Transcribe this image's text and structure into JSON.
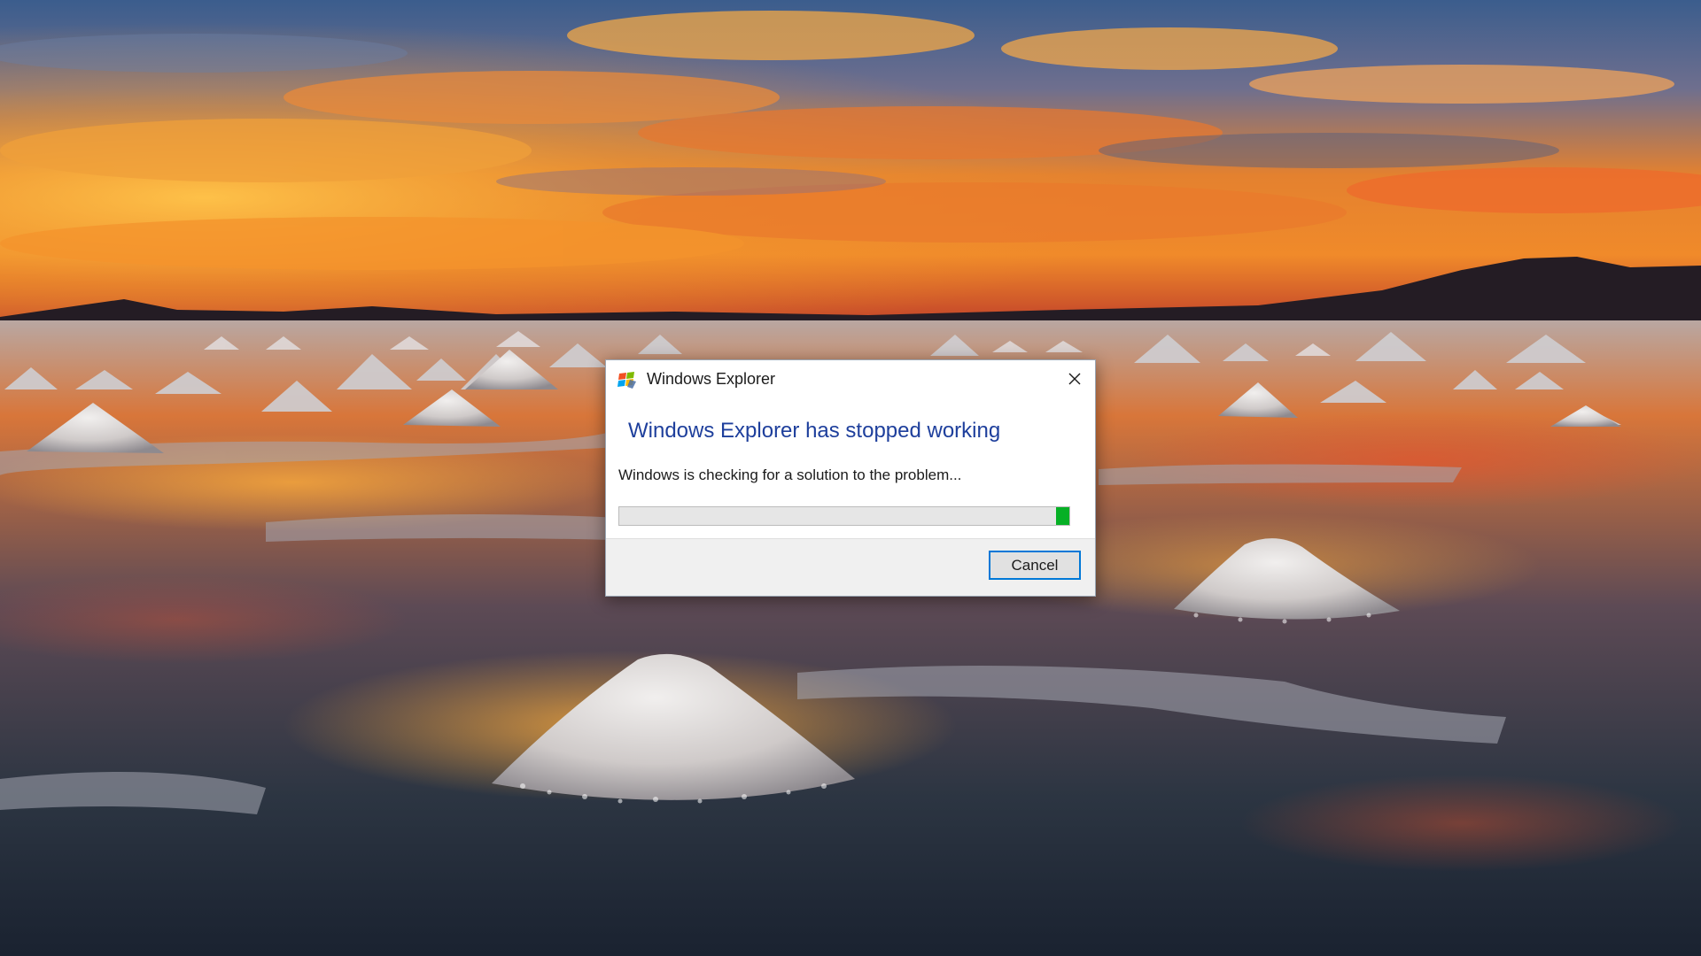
{
  "dialog": {
    "title": "Windows Explorer",
    "heading": "Windows Explorer has stopped working",
    "message": "Windows is checking for a solution to the problem...",
    "progress": {
      "style": "marquee",
      "segment_start": 0.97,
      "segment_end": 1.0,
      "color": "#06b025"
    },
    "cancel_label": "Cancel"
  },
  "icons": {
    "app": "windows-explorer-icon",
    "close": "close-icon"
  },
  "colors": {
    "heading": "#1e3f9c",
    "focus_border": "#0078d7",
    "footer_bg": "#f0f0f0"
  },
  "desktop": {
    "wallpaper": "sunset over salt flats with salt mounds reflected in water"
  }
}
